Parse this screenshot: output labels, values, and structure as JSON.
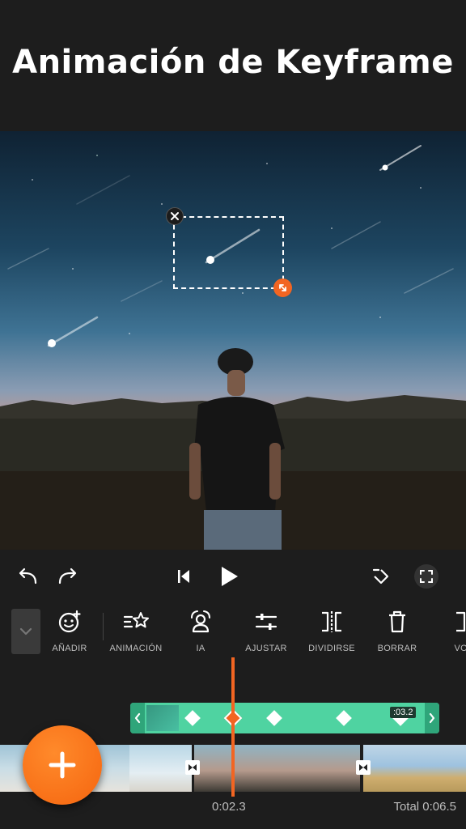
{
  "header": {
    "title": "Animación de Keyframe"
  },
  "toolbar": {
    "items": [
      {
        "label": "AÑADIR",
        "icon": "sticker-add-icon"
      },
      {
        "label": "ANIMACIÓN",
        "icon": "animation-star-icon"
      },
      {
        "label": "IA",
        "icon": "ai-person-icon"
      },
      {
        "label": "AJUSTAR",
        "icon": "adjust-sliders-icon"
      },
      {
        "label": "DIVIDIRSE",
        "icon": "split-icon"
      },
      {
        "label": "BORRAR",
        "icon": "trash-icon"
      },
      {
        "label": "VOLT",
        "icon": "flip-icon"
      }
    ]
  },
  "clip": {
    "duration_badge": ":03.2"
  },
  "timeline": {
    "current_time": "0:02.3",
    "total_time": "Total 0:06.5"
  },
  "colors": {
    "accent": "#f26522",
    "clip_green": "#4fd3a1",
    "background": "#1d1d1d"
  }
}
